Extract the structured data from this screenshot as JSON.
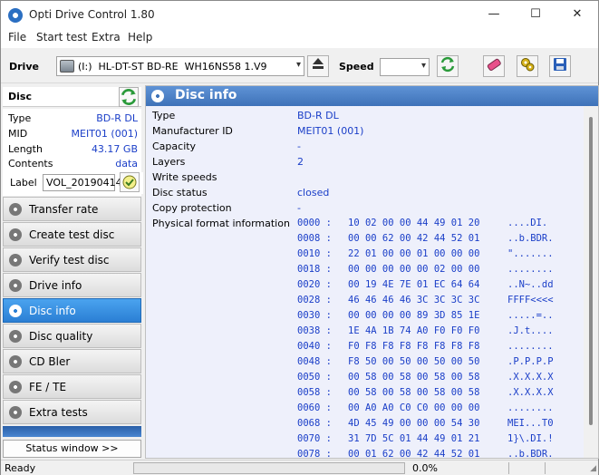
{
  "window": {
    "title": "Opti Drive Control 1.80",
    "minimize": "—",
    "maximize": "☐",
    "close": "✕"
  },
  "menu": [
    "File",
    "Start test",
    "Extra",
    "Help"
  ],
  "toolbar": {
    "drive_label": "Drive",
    "drive_value": "(I:)  HL-DT-ST BD-RE  WH16NS58 1.V9",
    "speed_label": "Speed",
    "speed_value": ""
  },
  "disc": {
    "header": "Disc",
    "properties": [
      {
        "key": "Type",
        "value": "BD-R DL"
      },
      {
        "key": "MID",
        "value": "MEIT01 (001)"
      },
      {
        "key": "Length",
        "value": "43.17 GB"
      },
      {
        "key": "Contents",
        "value": "data"
      }
    ],
    "label_key": "Label",
    "label_value": "VOL_20190414"
  },
  "nav": [
    {
      "label": "Transfer rate",
      "active": false
    },
    {
      "label": "Create test disc",
      "active": false
    },
    {
      "label": "Verify test disc",
      "active": false
    },
    {
      "label": "Drive info",
      "active": false
    },
    {
      "label": "Disc info",
      "active": true
    },
    {
      "label": "Disc quality",
      "active": false
    },
    {
      "label": "CD Bler",
      "active": false
    },
    {
      "label": "FE / TE",
      "active": false
    },
    {
      "label": "Extra tests",
      "active": false
    }
  ],
  "status_window_button": "Status window >>",
  "panel": {
    "title": "Disc info",
    "rows": [
      {
        "key": "Type",
        "value": "BD-R DL"
      },
      {
        "key": "Manufacturer ID",
        "value": "MEIT01 (001)"
      },
      {
        "key": "Capacity",
        "value": "-"
      },
      {
        "key": "Layers",
        "value": "2"
      },
      {
        "key": "Write speeds",
        "value": ""
      },
      {
        "key": "Disc status",
        "value": "closed"
      },
      {
        "key": "Copy protection",
        "value": "-"
      },
      {
        "key": "Physical format information",
        "value": ""
      }
    ],
    "hex": [
      {
        "off": "0000 :",
        "bytes": "10 02 00 00 44 49 01 20",
        "ascii": "....DI. "
      },
      {
        "off": "0008 :",
        "bytes": "00 00 62 00 42 44 52 01",
        "ascii": "..b.BDR."
      },
      {
        "off": "0010 :",
        "bytes": "22 01 00 00 01 00 00 00",
        "ascii": "\"......."
      },
      {
        "off": "0018 :",
        "bytes": "00 00 00 00 00 02 00 00",
        "ascii": "........"
      },
      {
        "off": "0020 :",
        "bytes": "00 19 4E 7E 01 EC 64 64",
        "ascii": "..N~..dd"
      },
      {
        "off": "0028 :",
        "bytes": "46 46 46 46 3C 3C 3C 3C",
        "ascii": "FFFF<<<<"
      },
      {
        "off": "0030 :",
        "bytes": "00 00 00 00 89 3D 85 1E",
        "ascii": ".....=.."
      },
      {
        "off": "0038 :",
        "bytes": "1E 4A 1B 74 A0 F0 F0 F0",
        "ascii": ".J.t...."
      },
      {
        "off": "0040 :",
        "bytes": "F0 F8 F8 F8 F8 F8 F8 F8",
        "ascii": "........"
      },
      {
        "off": "0048 :",
        "bytes": "F8 50 00 50 00 50 00 50",
        "ascii": ".P.P.P.P"
      },
      {
        "off": "0050 :",
        "bytes": "00 58 00 58 00 58 00 58",
        "ascii": ".X.X.X.X"
      },
      {
        "off": "0058 :",
        "bytes": "00 58 00 58 00 58 00 58",
        "ascii": ".X.X.X.X"
      },
      {
        "off": "0060 :",
        "bytes": "00 A0 A0 C0 C0 00 00 00",
        "ascii": "........"
      },
      {
        "off": "0068 :",
        "bytes": "4D 45 49 00 00 00 54 30",
        "ascii": "MEI...T0"
      },
      {
        "off": "0070 :",
        "bytes": "31 7D 5C 01 44 49 01 21",
        "ascii": "1}\\.DI.!"
      },
      {
        "off": "0078 :",
        "bytes": "00 01 62 00 42 44 52 01",
        "ascii": "..b.BDR."
      }
    ]
  },
  "status": {
    "text": "Ready",
    "progress": 0.0,
    "progress_text": "0.0%"
  }
}
